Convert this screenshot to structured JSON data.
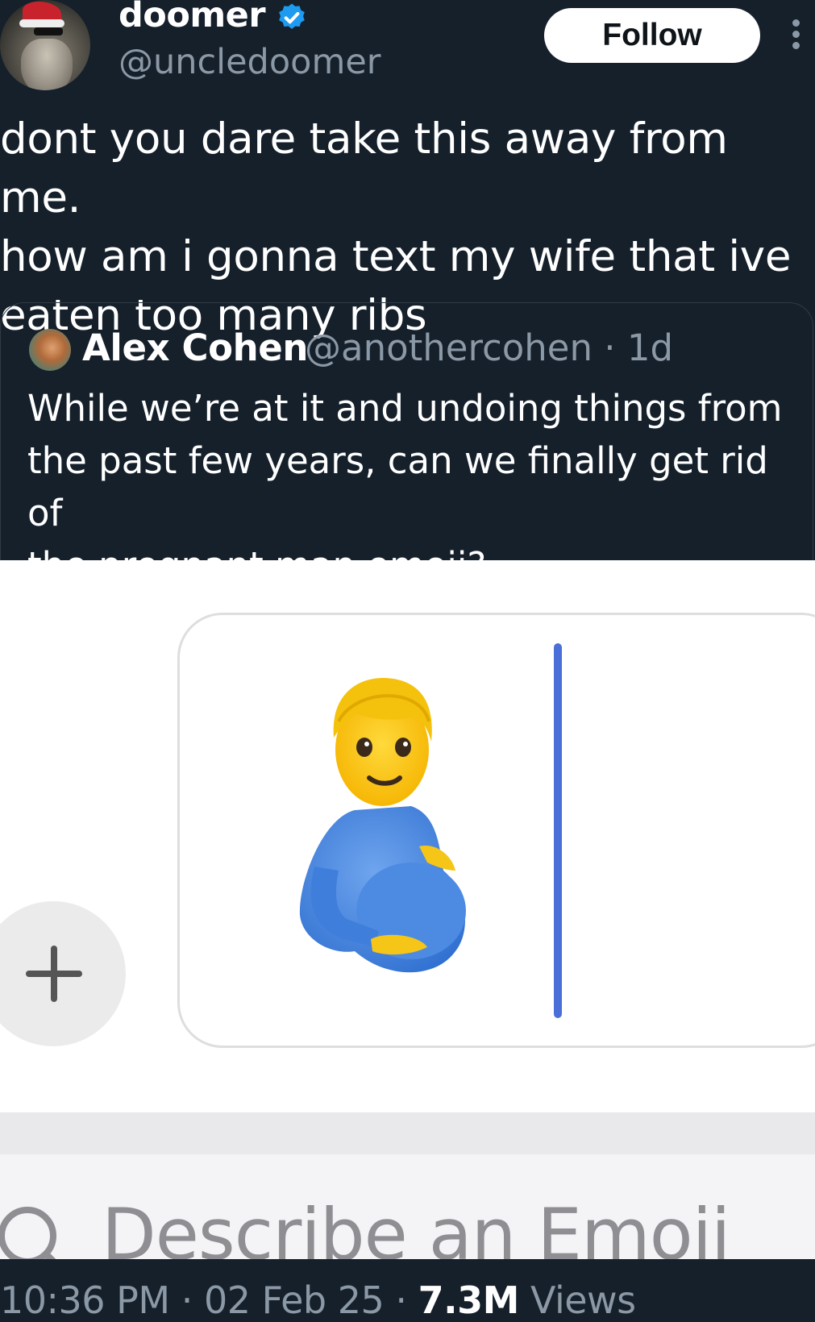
{
  "author": {
    "display_name": "doomer",
    "handle": "@uncledoomer",
    "verified": true
  },
  "follow_label": "Follow",
  "tweet": {
    "text_lines": [
      "dont you dare take this away from me.",
      "how am i gonna text my wife that ive",
      "eaten too many ribs"
    ]
  },
  "quote": {
    "display_name": "Alex Cohen",
    "handle_time": "@anothercohen · 1d",
    "text_lines": [
      "While we’re at it and undoing things from",
      "the past few years, can we finally get rid of",
      "the pregnant man emoji?"
    ]
  },
  "media": {
    "emoji": "pregnant-man-emoji",
    "search_placeholder": "Describe an Emoji"
  },
  "meta": {
    "time_date": "10:36 PM · 02 Feb 25 · ",
    "views_count": "7.3M",
    "views_label": " Views"
  },
  "colors": {
    "background": "#15202b",
    "secondary_text": "#8b98a5",
    "verified_blue": "#1d9bf0",
    "cursor_blue": "#4a6fd8"
  }
}
